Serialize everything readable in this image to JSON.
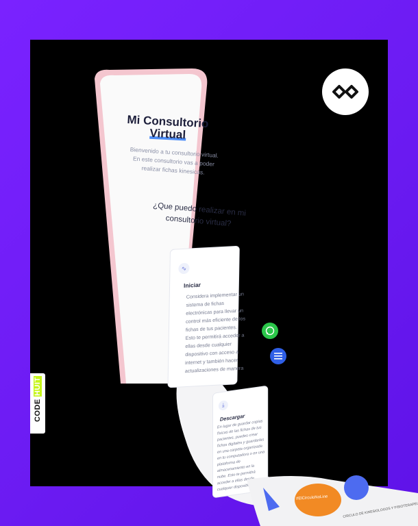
{
  "brand": {
    "badge_icon": "infinity-link-icon",
    "side_label_part1": "CODE",
    "side_label_part2": "HUIT"
  },
  "app": {
    "title_line1": "Mi Consultorio",
    "title_line2": "Virtual",
    "intro": "Bienvenido a tu consultorio virtual. En este consultorio vas a poder realizar fichas kinesicas.",
    "question": "¿Que puedo realizar en mi consultorio virtual?"
  },
  "cards": [
    {
      "icon": "activity-icon",
      "title": "Iniciar",
      "text": "Considera implementar un sistema de fichas electrónicas para llevar un control más eficiente de los fichas de tus pacientes. Esto te permitirá acceder a ellas desde cualquier dispositivo con acceso a internet y también hacer actualizaciones de manera"
    },
    {
      "icon": "download-icon",
      "title": "Descargar",
      "text": "En lugar de guardar copias físicas de las fichas de tus pacientes, puedes crear fichas digitales y guardarlas en una carpeta organizada en tu computadora o en una plataforma de almacenamiento en la nube. Esto te permitirá acceder a ellas desde cualquier dispositivo en la necesidad de tener fichas impresas"
    }
  ],
  "fabs": {
    "whatsapp_icon": "whatsapp-icon",
    "menu_icon": "menu-icon"
  },
  "footer": {
    "hashtag": "#ElCirculoNoLine",
    "caption": "CIRCULO DE KINESIOLOGOS Y FISIOTERAPEUTAS"
  },
  "colors": {
    "background": "#6b1bf2",
    "accent_blue": "#4d8df7",
    "whatsapp": "#2bc64a",
    "menu": "#2f5fe6",
    "phone": "#f4c6cf"
  }
}
